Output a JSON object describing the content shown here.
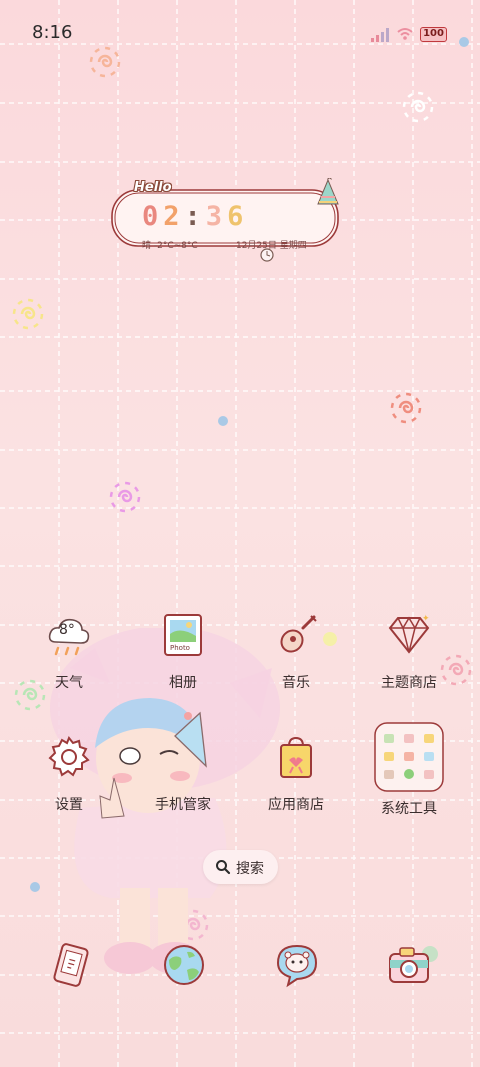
{
  "status_bar": {
    "time": "8:16",
    "battery": "100",
    "signal_icon": "signal-bars-icon",
    "wifi_icon": "wifi-icon"
  },
  "widget": {
    "hello": "Hello",
    "time_h1": "0",
    "time_h2": "2",
    "time_sep": ":",
    "time_m1": "3",
    "time_m2": "6",
    "weather": "晴 -2°C~8°C",
    "date": "12月25日 星期四"
  },
  "apps": {
    "weather_temp": "8°",
    "weather": "天气",
    "gallery": "相册",
    "gallery_badge": "Photo",
    "music": "音乐",
    "themes": "主题商店",
    "settings": "设置",
    "phone_manager": "手机管家",
    "app_store": "应用商店",
    "system_tools": "系统工具"
  },
  "search": {
    "label": "搜索"
  },
  "dock": [
    "phone-icon",
    "browser-globe-icon",
    "messages-icon",
    "camera-icon"
  ],
  "colors": {
    "background": "#fbdcdf",
    "accent": "#c0393d",
    "text": "#3a2e2e"
  }
}
